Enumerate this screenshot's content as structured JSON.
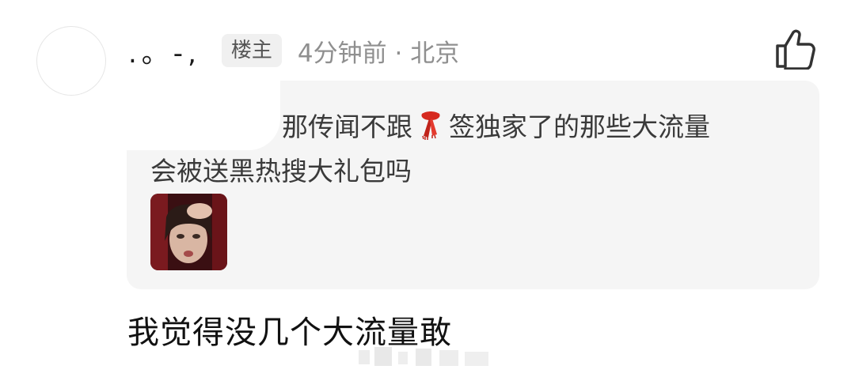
{
  "comment": {
    "username": ".。-,",
    "op_badge": "楼主",
    "meta": "4分钟前 · 北京",
    "quote": {
      "line1_part1": "那传闻不跟",
      "line1_part2": "签独家了的那些大流量",
      "line2": "会被送黑热搜大礼包吗",
      "inline_icon": "red-scarf-emoji",
      "image": "meme-reaction-image"
    },
    "reply_text": "我觉得没几个大流量敢"
  },
  "icons": {
    "like": "thumbs-up-icon"
  },
  "colors": {
    "quote_bg": "#f5f5f5",
    "meta_text": "#8f8f8f",
    "badge_bg": "#f0f0f0",
    "scarf": "#d62a1f"
  }
}
